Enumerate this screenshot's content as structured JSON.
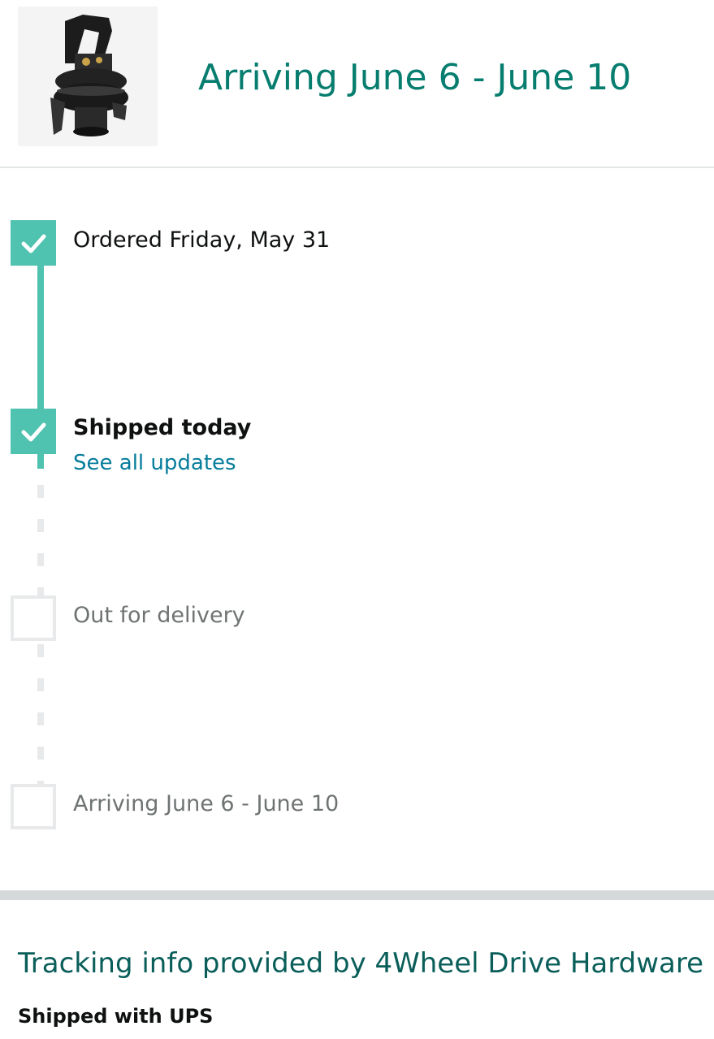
{
  "header": {
    "arrival_title": "Arriving June 6 - June 10",
    "product_image": "air-spring-product-photo"
  },
  "timeline": {
    "steps": [
      {
        "label": "Ordered Friday, May 31",
        "status": "done"
      },
      {
        "label": "Shipped today",
        "status": "done",
        "link": "See all updates"
      },
      {
        "label": "Out for delivery",
        "status": "pending"
      },
      {
        "label": "Arriving June 6 - June 10",
        "status": "pending"
      }
    ]
  },
  "tracking": {
    "title": "Tracking info provided by 4Wheel Drive Hardware",
    "carrier": "Shipped with UPS"
  },
  "colors": {
    "accent_teal": "#067d6e",
    "progress_green": "#50c2b0",
    "link_blue": "#067d9c",
    "pending_gray": "#6f7373"
  },
  "icons": [
    "check-icon",
    "empty-step-icon"
  ]
}
